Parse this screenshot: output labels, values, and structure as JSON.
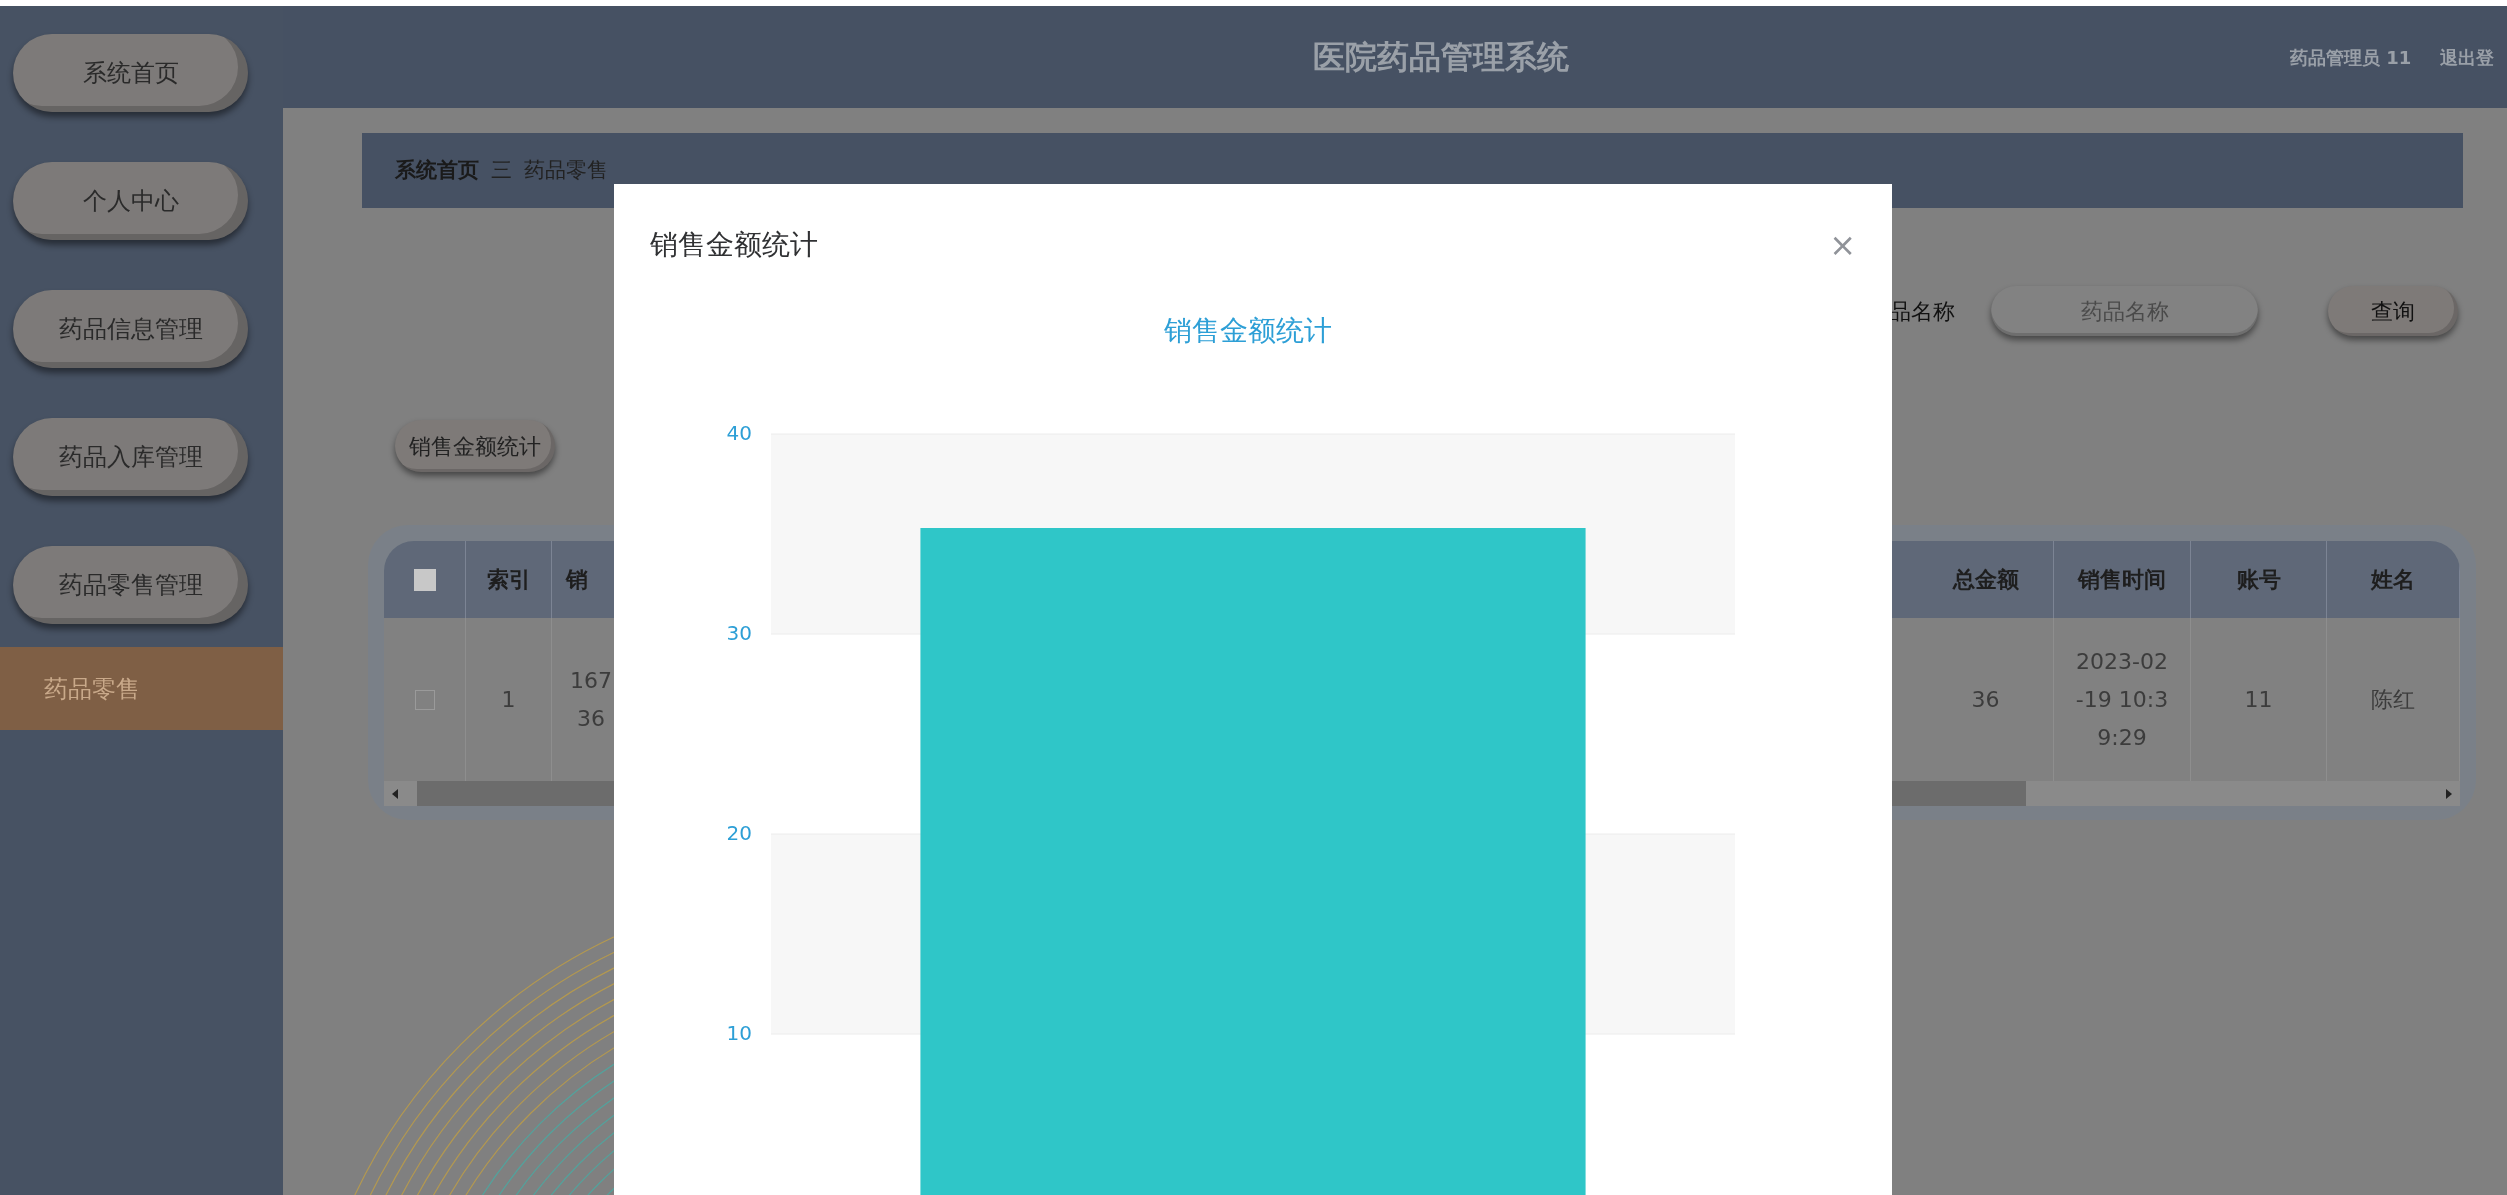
{
  "header": {
    "title": "医院药品管理系统",
    "user": "药品管理员 11",
    "logout": "退出登"
  },
  "sidebar": {
    "items": [
      {
        "label": "系统首页",
        "kind": "button",
        "selected": false
      },
      {
        "label": "个人中心",
        "kind": "button",
        "selected": false
      },
      {
        "label": "药品信息管理",
        "kind": "button",
        "selected": false
      },
      {
        "label": "药品入库管理",
        "kind": "button",
        "selected": false
      },
      {
        "label": "药品零售管理",
        "kind": "button",
        "selected": false
      },
      {
        "label": "药品零售",
        "kind": "subitem",
        "selected": true
      }
    ]
  },
  "breadcrumb": {
    "home": "系统首页",
    "separator": "三",
    "current": "药品零售"
  },
  "search": {
    "label": "品名称",
    "placeholder": "药品名称",
    "button": "查询"
  },
  "stat_button": "销售金额统计",
  "table": {
    "all_checked": false,
    "columns": [
      "索引",
      "销",
      "总金额",
      "销售时间",
      "账号",
      "姓名"
    ],
    "rows": [
      {
        "checked": false,
        "cells": [
          "1",
          "167\n36",
          "36",
          "2023-02\n-19 10:3\n9:29",
          "11",
          "陈红"
        ]
      }
    ]
  },
  "modal": {
    "title": "销售金额统计",
    "close": "×",
    "chart_data": {
      "type": "bar",
      "title": "销售金额统计",
      "ylim": [
        0,
        40
      ],
      "grid": true,
      "yticks": [
        10,
        20,
        30,
        40
      ],
      "series": [
        {
          "color": "#2fc6c8",
          "values": [
            35.3
          ]
        }
      ]
    }
  }
}
